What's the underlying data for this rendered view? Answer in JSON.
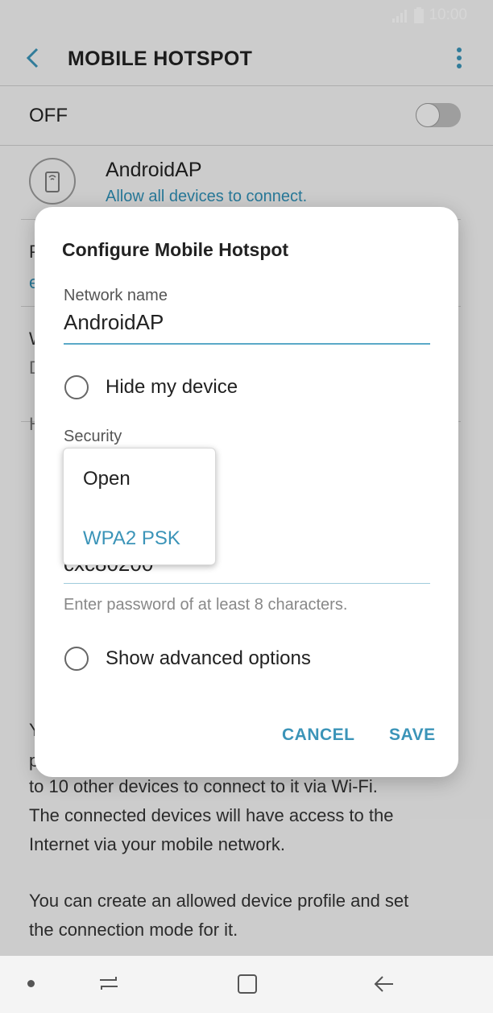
{
  "status": {
    "time": "10:00"
  },
  "header": {
    "title": "MOBILE HOTSPOT"
  },
  "hotspot": {
    "state_label": "OFF",
    "network": "AndroidAP",
    "subtitle": "Allow all devices to connect."
  },
  "background": {
    "fragments": [
      "P",
      "e",
      "W",
      "D",
      "H",
      "Y",
      "p"
    ],
    "lines": [
      "to 10 other devices to connect to it via Wi-Fi.",
      "The connected devices will have access to the",
      "Internet via your mobile network.",
      "",
      "You can create an allowed device profile and set",
      "the connection mode for it."
    ]
  },
  "dialog": {
    "title": "Configure Mobile Hotspot",
    "network_label": "Network name",
    "network_value": "AndroidAP",
    "hide_device_label": "Hide my device",
    "security_label": "Security",
    "password_fragment": "cxc80200",
    "password_hint": "Enter password of at least 8 characters.",
    "advanced_label": "Show advanced options",
    "cancel_label": "CANCEL",
    "save_label": "SAVE"
  },
  "security_dropdown": {
    "options": [
      {
        "label": "Open",
        "selected": false
      },
      {
        "label": "WPA2 PSK",
        "selected": true
      }
    ]
  },
  "colors": {
    "accent": "#3b94b8",
    "link": "#2f8fb5"
  }
}
